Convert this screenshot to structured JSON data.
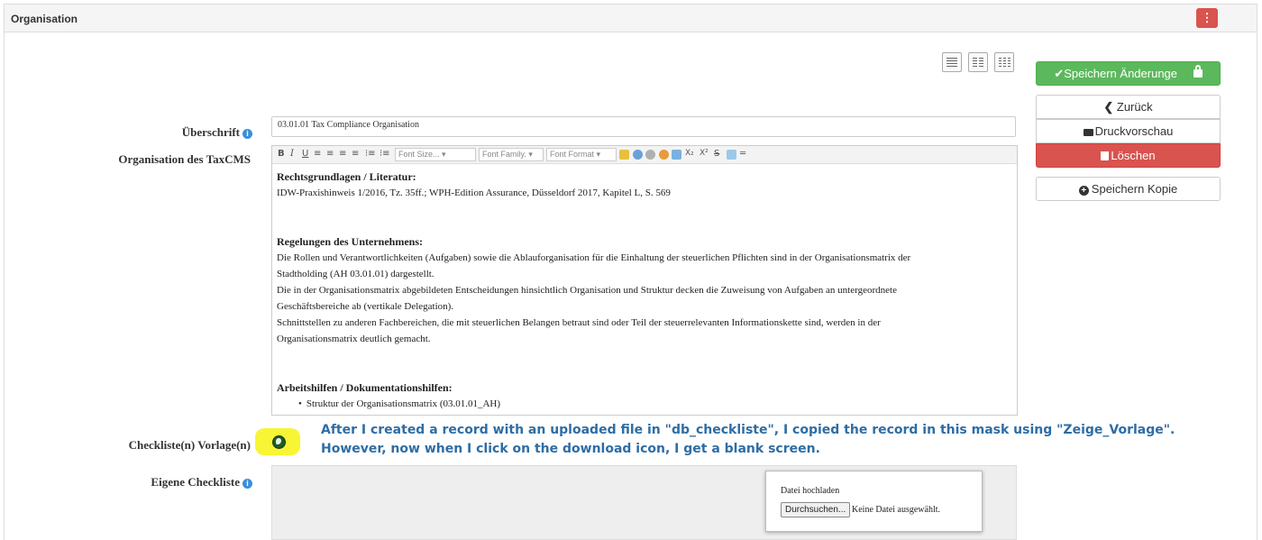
{
  "panel": {
    "title": "Organisation",
    "menu_glyph": "⋮"
  },
  "actions": {
    "save_changes": "Speichern Änderunge",
    "back": "Zurück",
    "print_preview": "Druckvorschau",
    "delete": "Löschen",
    "save_copy": "Speichern Kopie"
  },
  "form": {
    "headline_label": "Überschrift",
    "headline_value": "03.01.01 Tax Compliance Organisation",
    "org_label": "Organisation des TaxCMS",
    "checklist_template_label": "Checkliste(n) Vorlage(n)",
    "own_checklist_label": "Eigene Checkliste"
  },
  "toolbar": {
    "font_size": "Font Size...",
    "font_family": "Font Family.",
    "font_format": "Font Format"
  },
  "content": {
    "h1": "Rechtsgrundlagen / Literatur:",
    "p1": "IDW-Praxishinweis 1/2016, Tz. 35ff.; WPH-Edition Assurance, Düsseldorf 2017, Kapitel L, S. 569",
    "h2": "Regelungen des Unternehmens:",
    "p2a": "Die Rollen und Verantwortlichkeiten (Aufgaben) sowie die Ablauforganisation für die Einhaltung der steuerlichen Pflichten sind in der Organisationsmatrix der",
    "p2b": "Stadtholding (AH 03.01.01) dargestellt.",
    "p2c": "Die in der Organisationsmatrix abgebildeten Entscheidungen hinsichtlich Organisation und Struktur decken die Zuweisung von Aufgaben an untergeordnete",
    "p2d": "Geschäftsbereiche ab (vertikale Delegation).",
    "p2e": "Schnittstellen zu anderen Fachbereichen, die mit steuerlichen Belangen betraut sind oder Teil der steuerrelevanten Informationskette sind, werden in der",
    "p2f": "Organisationsmatrix deutlich gemacht.",
    "h3": "Arbeitshilfen / Dokumentationshilfen:",
    "li1": "Struktur der Organisationsmatrix (03.01.01_AH)"
  },
  "annotation": {
    "line1": "After I created a record with an uploaded file in \"db_checkliste\", I copied the record in this mask using \"Zeige_Vorlage\".",
    "line2": "However, now when I click on the download icon, I get a blank screen."
  },
  "upload": {
    "title": "Datei hochladen",
    "browse": "Durchsuchen...",
    "no_file": "Keine Datei ausgewählt."
  },
  "colors": {
    "success": "#5cb85c",
    "danger": "#d9534f",
    "annotation": "#2e6da4",
    "highlight": "#f8f535"
  },
  "icons": [
    "checkmark-icon",
    "lock-icon",
    "chevron-left-icon",
    "printer-icon",
    "trash-icon",
    "plus-circle-icon",
    "info-icon",
    "globe-icon",
    "kebab-menu-icon"
  ]
}
